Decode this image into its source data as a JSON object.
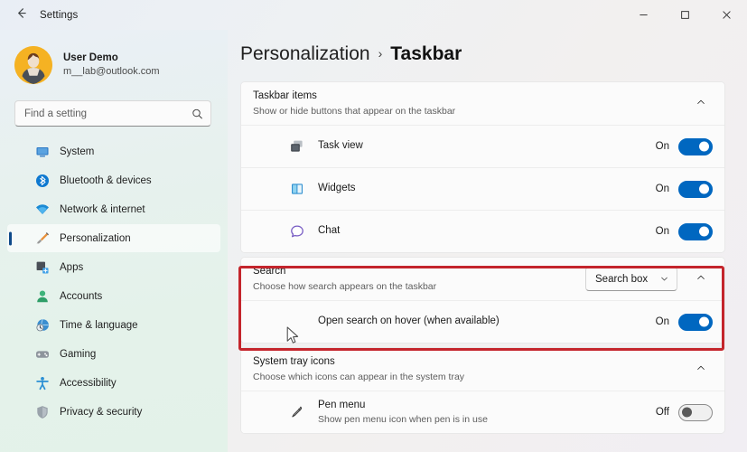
{
  "window": {
    "app_title": "Settings",
    "back_icon": "back-arrow-icon",
    "minimize_label": "─",
    "maximize_label": "□",
    "close_label": "✕"
  },
  "accent_color": "#0067c0",
  "annotation_color": "#c4252c",
  "sidebar": {
    "profile": {
      "name": "User Demo",
      "email": "m__lab@outlook.com"
    },
    "search": {
      "placeholder": "Find a setting",
      "icon": "search-icon"
    },
    "items": [
      {
        "label": "System",
        "icon": "monitor-icon",
        "selected": false
      },
      {
        "label": "Bluetooth & devices",
        "icon": "bluetooth-icon",
        "selected": false
      },
      {
        "label": "Network & internet",
        "icon": "wifi-icon",
        "selected": false
      },
      {
        "label": "Personalization",
        "icon": "paintbrush-icon",
        "selected": true
      },
      {
        "label": "Apps",
        "icon": "apps-icon",
        "selected": false
      },
      {
        "label": "Accounts",
        "icon": "person-icon",
        "selected": false
      },
      {
        "label": "Time & language",
        "icon": "clock-globe-icon",
        "selected": false
      },
      {
        "label": "Gaming",
        "icon": "gamepad-icon",
        "selected": false
      },
      {
        "label": "Accessibility",
        "icon": "accessibility-icon",
        "selected": false
      },
      {
        "label": "Privacy & security",
        "icon": "shield-icon",
        "selected": false
      }
    ]
  },
  "main": {
    "breadcrumb": {
      "parent": "Personalization",
      "separator": "›",
      "current": "Taskbar"
    },
    "sections": [
      {
        "id": "taskbar-items",
        "title": "Taskbar items",
        "description": "Show or hide buttons that appear on the taskbar",
        "expander_icon": "chevron-up-icon",
        "rows": [
          {
            "label": "Task view",
            "icon": "task-view-icon",
            "state": "On",
            "toggle": "on"
          },
          {
            "label": "Widgets",
            "icon": "widgets-icon",
            "state": "On",
            "toggle": "on"
          },
          {
            "label": "Chat",
            "icon": "chat-icon",
            "state": "On",
            "toggle": "on"
          }
        ]
      },
      {
        "id": "search",
        "title": "Search",
        "description": "Choose how search appears on the taskbar",
        "dropdown_value": "Search box",
        "dropdown_icon": "chevron-down-icon",
        "expander_icon": "chevron-up-icon",
        "highlighted": true,
        "rows": [
          {
            "label": "Open search on hover (when available)",
            "icon": "cursor-pointer-icon",
            "state": "On",
            "toggle": "on"
          }
        ]
      },
      {
        "id": "system-tray-icons",
        "title": "System tray icons",
        "description": "Choose which icons can appear in the system tray",
        "expander_icon": "chevron-up-icon",
        "rows": [
          {
            "label": "Pen menu",
            "description": "Show pen menu icon when pen is in use",
            "icon": "pen-icon",
            "state": "Off",
            "toggle": "off"
          }
        ]
      }
    ]
  }
}
